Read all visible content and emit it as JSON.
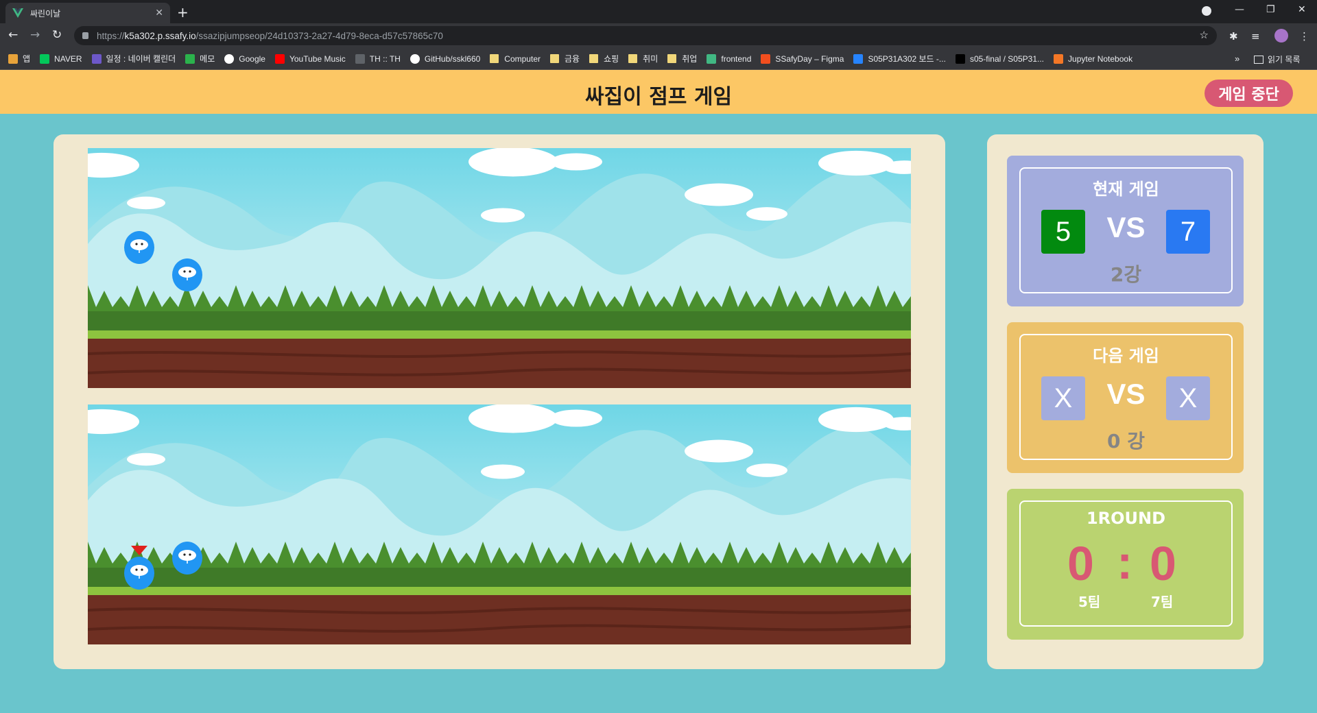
{
  "browser": {
    "tab_title": "싸린이날",
    "url_prefix": "https://",
    "url_host": "k5a302.p.ssafy.io",
    "url_path": "/ssazipjumpseop/24d10373-2a27-4d79-8eca-d57c57865c70",
    "bookmarks": [
      {
        "label": "앱",
        "icon": "apps-grid-icon",
        "color": "#e8a33a"
      },
      {
        "label": "NAVER",
        "icon": "naver-icon",
        "color": "#03c75a"
      },
      {
        "label": "일정 : 네이버 캘린더",
        "icon": "calendar-icon",
        "color": "#6d58c9"
      },
      {
        "label": "메모",
        "icon": "memo-icon",
        "color": "#2bb24c"
      },
      {
        "label": "Google",
        "icon": "google-icon",
        "color": "#ffffff"
      },
      {
        "label": "YouTube Music",
        "icon": "youtube-music-icon",
        "color": "#ff0000"
      },
      {
        "label": "TH :: TH",
        "icon": "dots-icon",
        "color": "#5f6368"
      },
      {
        "label": "GitHub/sskl660",
        "icon": "github-icon",
        "color": "#ffffff"
      },
      {
        "label": "Computer",
        "icon": "folder-icon",
        "color": "#f1d77a"
      },
      {
        "label": "금융",
        "icon": "folder-icon",
        "color": "#f1d77a"
      },
      {
        "label": "쇼핑",
        "icon": "folder-icon",
        "color": "#f1d77a"
      },
      {
        "label": "취미",
        "icon": "folder-icon",
        "color": "#f1d77a"
      },
      {
        "label": "취업",
        "icon": "folder-icon",
        "color": "#f1d77a"
      },
      {
        "label": "frontend",
        "icon": "vue-icon",
        "color": "#41b883"
      },
      {
        "label": "SSafyDay – Figma",
        "icon": "figma-icon",
        "color": "#f24e1e"
      },
      {
        "label": "S05P31A302 보드 -...",
        "icon": "jira-icon",
        "color": "#2684ff"
      },
      {
        "label": "s05-final / S05P31...",
        "icon": "terminal-icon",
        "color": "#000000"
      },
      {
        "label": "Jupyter Notebook",
        "icon": "jupyter-icon",
        "color": "#f37726"
      }
    ],
    "bookmarks_more": "»",
    "reading_list": "읽기 목록"
  },
  "header": {
    "title": "싸집이 점프 게임",
    "stop_button": "게임 중단"
  },
  "scoreboard": {
    "current_game": {
      "title": "현재 게임",
      "left_team": "5",
      "vs": "VS",
      "right_team": "7",
      "round": "2강",
      "left_color": "#028a0f",
      "right_color": "#2979f2",
      "bg": "#a3acdd"
    },
    "next_game": {
      "title": "다음 게임",
      "left_team": "X",
      "vs": "VS",
      "right_team": "X",
      "round": "0 강",
      "box_color": "#a3acdd",
      "bg": "#ecc26b"
    },
    "round_score": {
      "title": "1ROUND",
      "left_score": "0",
      "separator": ":",
      "right_score": "0",
      "left_team": "5팀",
      "right_team": "7팀",
      "bg": "#bad370",
      "score_color": "#d85873"
    }
  },
  "game": {
    "player_color": "#2196f3",
    "marker_color": "#e0201b"
  }
}
